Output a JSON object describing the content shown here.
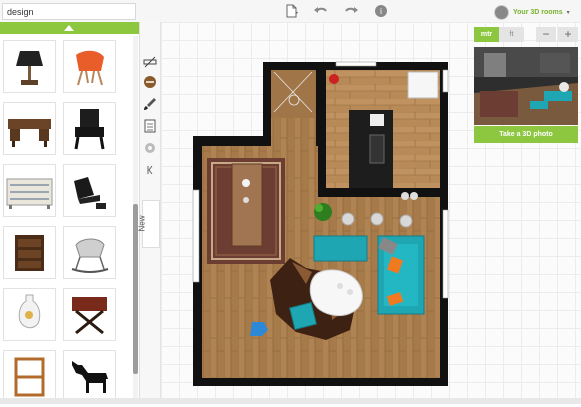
{
  "search": {
    "value": "design",
    "icon": "search-icon"
  },
  "toolbar": {
    "icons": [
      "new-file-icon",
      "undo-icon",
      "redo-icon",
      "help-icon"
    ]
  },
  "user": {
    "label": "Your 3D rooms",
    "caret": "▾"
  },
  "sidebar": {
    "items": [
      "table-lamp",
      "orange-shell-chair",
      "wooden-desk",
      "black-baroque-armchair",
      "painted-chest",
      "black-lounge-chair",
      "wooden-cabinet",
      "rocking-chair",
      "white-vase",
      "folding-side-table",
      "wooden-armchair",
      "black-horse-statue"
    ]
  },
  "tools": [
    "draw-wall-icon",
    "furniture-icon",
    "paint-brush-icon",
    "checklist-icon",
    "settings-icon",
    "collapse-icon"
  ],
  "new_tab": {
    "label": "New"
  },
  "units": {
    "active": "mtr",
    "inactive": "ft"
  },
  "zoom": {
    "minus": "−",
    "plus": "+"
  },
  "photo_button": {
    "label": "Take a 3D photo"
  },
  "colors": {
    "accent": "#8dc63f",
    "wall": "#111111",
    "wood": "#a77a4a",
    "teal": "#1ea7b3"
  }
}
